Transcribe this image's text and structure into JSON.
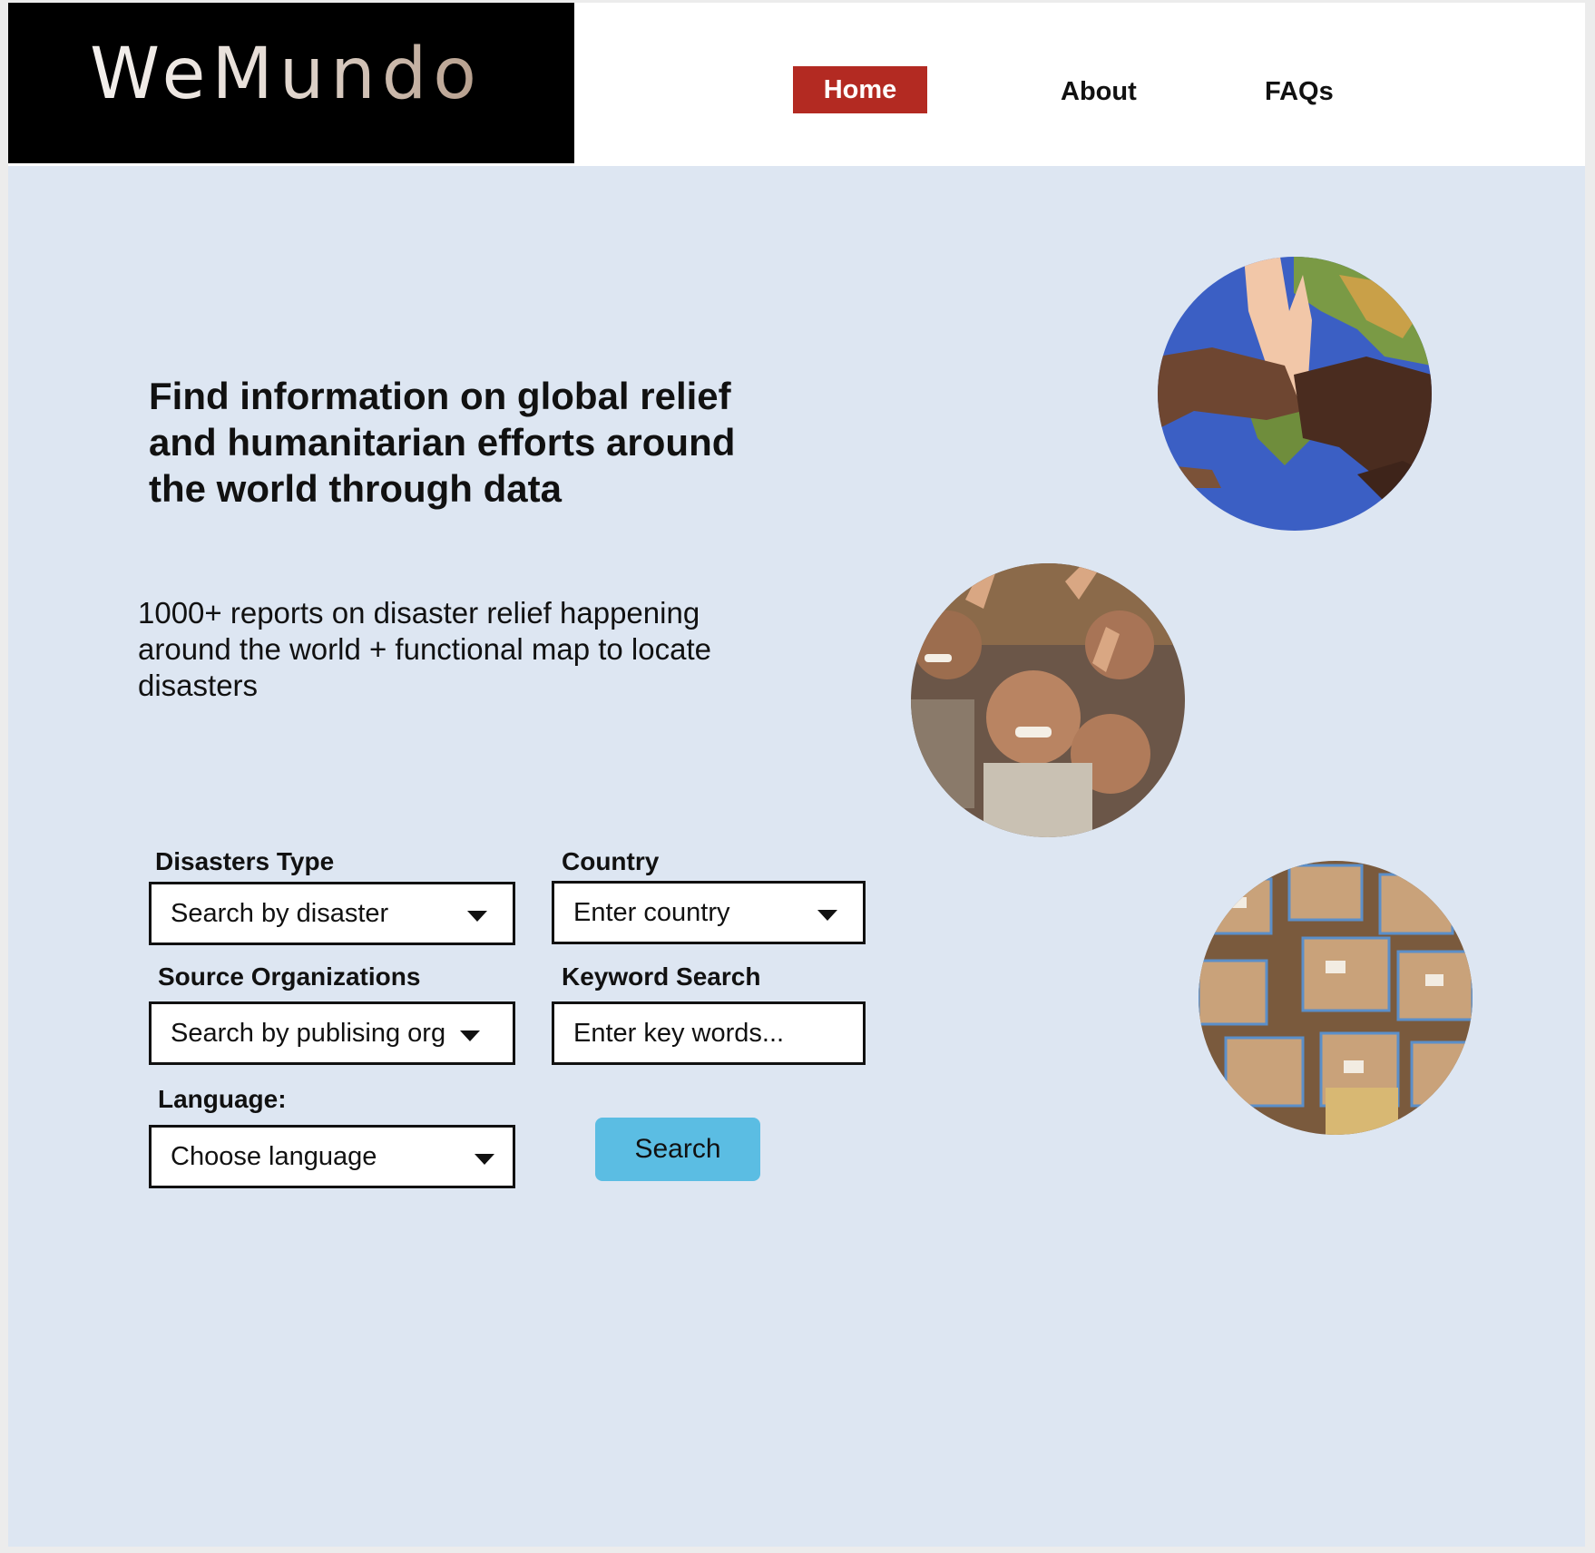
{
  "brand": {
    "logo_text": "WeMundo"
  },
  "nav": {
    "home": "Home",
    "about": "About",
    "faqs": "FAQs",
    "active_color": "#b32a22"
  },
  "hero": {
    "headline": "Find information on global relief and humanitarian efforts around the world through data",
    "subtext": "1000+ reports on disaster relief happening around the world + functional map to locate disasters"
  },
  "search_form": {
    "disaster_type": {
      "label": "Disasters Type",
      "value": "Search by disaster"
    },
    "country": {
      "label": "Country",
      "value": "Enter country"
    },
    "source_org": {
      "label": "Source Organizations",
      "value": "Search by publising org"
    },
    "keyword": {
      "label": "Keyword Search",
      "placeholder": "Enter key words..."
    },
    "language": {
      "label": "Language:",
      "value": "Choose language"
    },
    "search_button": "Search",
    "button_color": "#5bbde3"
  },
  "images": [
    {
      "name": "hands-on-globe-photo"
    },
    {
      "name": "smiling-children-photo"
    },
    {
      "name": "aid-supply-boxes-photo"
    }
  ],
  "colors": {
    "background": "#dde6f2",
    "header": "#ffffff",
    "logo_bg": "#000000"
  }
}
